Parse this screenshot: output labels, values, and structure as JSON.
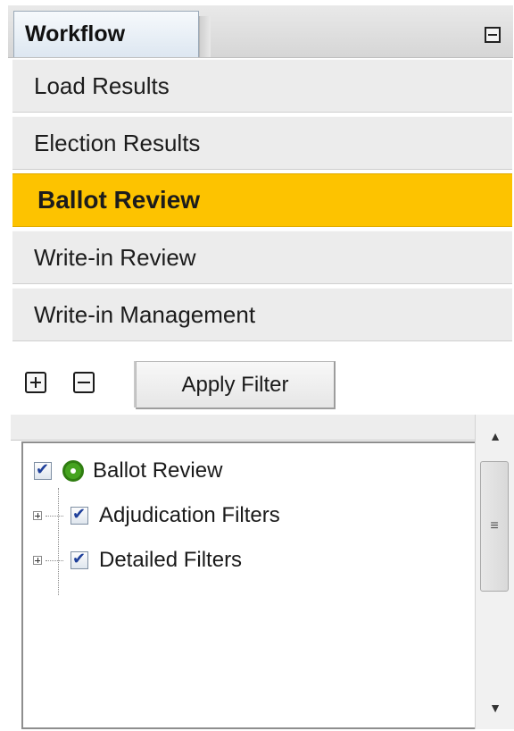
{
  "header": {
    "tab_label": "Workflow",
    "minimize_icon": "minimize-icon"
  },
  "workflow": {
    "items": [
      {
        "label": "Load Results",
        "active": false
      },
      {
        "label": "Election Results",
        "active": false
      },
      {
        "label": "Ballot Review",
        "active": true
      },
      {
        "label": "Write-in Review",
        "active": false
      },
      {
        "label": "Write-in Management",
        "active": false
      }
    ]
  },
  "toolbar": {
    "expand_icon": "expand-all-icon",
    "collapse_icon": "collapse-all-icon",
    "apply_filter_label": "Apply Filter"
  },
  "tree": {
    "root": {
      "label": "Ballot Review",
      "checked": true,
      "icon": "status-dot-icon"
    },
    "children": [
      {
        "label": "Adjudication Filters",
        "checked": true,
        "expandable": true
      },
      {
        "label": "Detailed Filters",
        "checked": true,
        "expandable": true
      }
    ]
  },
  "scrollbar": {
    "up_icon": "scroll-up-icon",
    "down_icon": "scroll-down-icon",
    "grip_icon": "scroll-grip-icon"
  },
  "colors": {
    "active_item": "#fdc300",
    "item_bg": "#ececec",
    "tab_bg": "#dde7f1"
  }
}
